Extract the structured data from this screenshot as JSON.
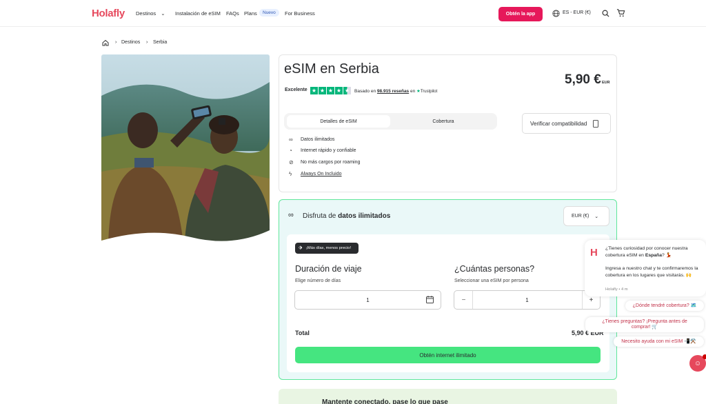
{
  "header": {
    "logo": "Holafly",
    "nav": [
      "Destinos",
      "Instalación de eSIM",
      "FAQs",
      "Plans"
    ],
    "new_badge": "Nuevo",
    "for_business": "For Business",
    "app_button": "Obtén la app",
    "lang": "ES - EUR (€)"
  },
  "breadcrumb": [
    "Destinos",
    "Serbia"
  ],
  "product": {
    "title": "eSIM en Serbia",
    "price": "5,90 €",
    "currency": "EUR",
    "rating_label": "Excelente",
    "stars": 4.5,
    "basado": "Basado en",
    "reviews": "98.915 reseñas",
    "en": "en",
    "trustpilot": "Trustpilot",
    "tabs": [
      "Detalles de eSIM",
      "Cobertura"
    ],
    "verify_button": "Verificar compatibilidad",
    "features": [
      "Datos ilimitados",
      "Internet rápido y confiable",
      "No más cargos por roaming",
      "Always On Incluido"
    ]
  },
  "plan": {
    "title_prefix": "Disfruta de",
    "title_bold": "datos ilimitados",
    "currency_select": "EUR (€)",
    "promo": "¡Más días, menos precio!",
    "duration_title": "Duración de viaje",
    "duration_sub": "Elige número de días",
    "duration_value": "1",
    "people_title": "¿Cuántas personas?",
    "people_sub": "Seleccionar una eSIM por persona",
    "people_value": "1",
    "minus": "−",
    "plus": "+",
    "total_label": "Total",
    "total_price": "5,90 € EUR",
    "cta": "Obtén internet ilimitado"
  },
  "bottom_teaser": "Mantente conectado, pase lo que pase",
  "chat": {
    "message1_pre": "¿Tienes curiosidad por conocer nuestra cobertura eSIM en",
    "message1_bold": "España",
    "message1_post": "? 💃",
    "message2": "Ingresa a nuestro chat y te confirmaremos la cobertura en los lugares que visitarás. 🙌",
    "meta": "Holafly • 4 m",
    "quick_replies": [
      "¿Dónde tendré cobertura? 🗺️",
      "¿Tienes preguntas? ¡Pregunta antes de comprar! 🛒",
      "Necesito ayuda con mi eSIM 📲⚒️"
    ]
  },
  "colors": {
    "brand": "#e6485c",
    "app_button": "#e6185a",
    "cta": "#45e580",
    "trustpilot": "#00b67a"
  }
}
